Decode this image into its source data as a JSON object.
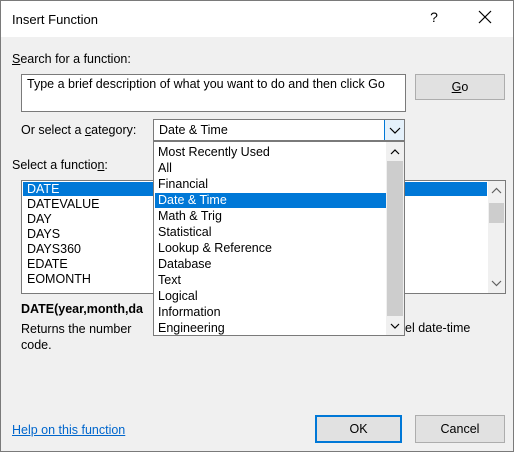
{
  "window": {
    "title": "Insert Function",
    "help_glyph": "?"
  },
  "search": {
    "label_prefix": "",
    "label_hot": "S",
    "label_rest": "earch for a function:",
    "value": "Type a brief description of what you want to do and then click Go",
    "go_hot": "G",
    "go_rest": "o"
  },
  "category": {
    "label_a": "Or select a ",
    "label_hot": "c",
    "label_b": "ategory:",
    "selected": "Date & Time",
    "options": [
      "Most Recently Used",
      "All",
      "Financial",
      "Date & Time",
      "Math & Trig",
      "Statistical",
      "Lookup & Reference",
      "Database",
      "Text",
      "Logical",
      "Information",
      "Engineering"
    ]
  },
  "functions": {
    "label_a": "Select a functio",
    "label_hot": "n",
    "label_b": ":",
    "items": [
      "DATE",
      "DATEVALUE",
      "DAY",
      "DAYS",
      "DAYS360",
      "EDATE",
      "EOMONTH"
    ]
  },
  "details": {
    "signature": "DATE(year,month,da",
    "description_a": "Returns the number",
    "description_b": "code.",
    "description_right": "el date-time"
  },
  "footer": {
    "help_link": "Help on this function",
    "ok": "OK",
    "cancel": "Cancel"
  },
  "colors": {
    "accent": "#0078d7",
    "link": "#0066cc"
  }
}
